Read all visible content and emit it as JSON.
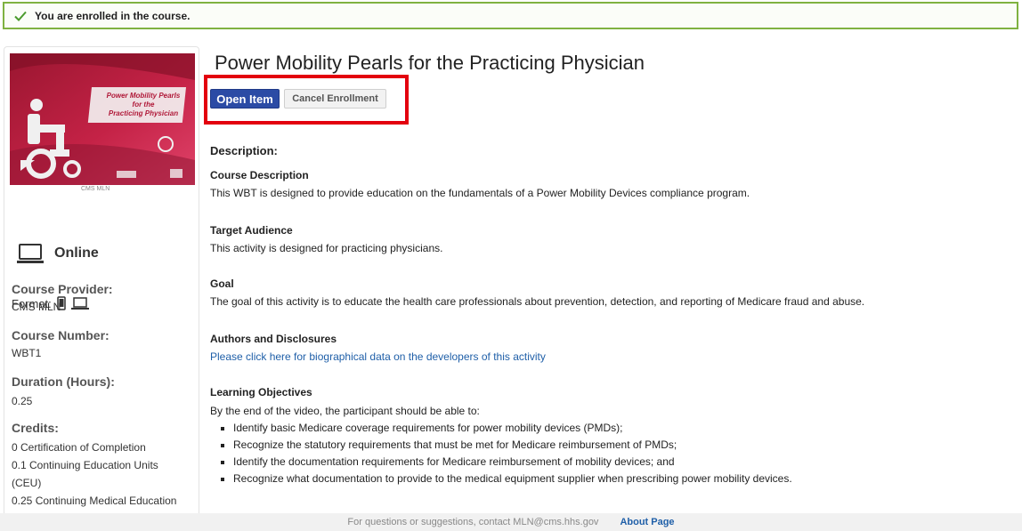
{
  "banner": {
    "message": "You are enrolled in the course.",
    "icon": "checkmark-icon",
    "color": "#7fb241"
  },
  "sidebar": {
    "thumbnail": {
      "title_lines": [
        "Power Mobility Pearls",
        "for the",
        "Practicing Physician"
      ],
      "caption": "CMS MLN"
    },
    "delivery": {
      "icon": "laptop-icon",
      "label": "Online"
    },
    "format": {
      "label": "Format:",
      "icons": [
        "mobile-icon",
        "laptop-icon"
      ]
    },
    "provider": {
      "label": "Course Provider:",
      "value": "CMS MLN"
    },
    "number": {
      "label": "Course Number:",
      "value": "WBT1"
    },
    "duration": {
      "label": "Duration (Hours):",
      "value": "0.25"
    },
    "credits": {
      "label": "Credits:",
      "values": [
        "0 Certification of Completion",
        "0.1 Continuing Education Units",
        "(CEU)",
        "0.25 Continuing Medical Education"
      ]
    }
  },
  "main": {
    "title": "Power Mobility Pearls for the Practicing Physician",
    "buttons": {
      "open": "Open Item",
      "cancel": "Cancel Enrollment"
    },
    "description_heading": "Description:",
    "sections": {
      "course_description": {
        "heading": "Course Description",
        "text": "This WBT is designed to provide education on the fundamentals of a Power Mobility Devices compliance program."
      },
      "target_audience": {
        "heading": "Target Audience",
        "text": "This activity is designed for practicing physicians."
      },
      "goal": {
        "heading": "Goal",
        "text": "The goal of this activity is to educate the health care professionals about prevention, detection, and reporting of Medicare fraud and abuse."
      },
      "authors": {
        "heading": "Authors and Disclosures",
        "link": "Please click here for biographical data on the developers of this activity"
      },
      "objectives": {
        "heading": "Learning Objectives",
        "intro": "By the end of the video, the participant should be able to:",
        "items": [
          "Identify basic Medicare coverage requirements for power mobility devices (PMDs);",
          "Recognize the statutory requirements that must be met for Medicare reimbursement of PMDs;",
          "Identify the documentation requirements for Medicare reimbursement of mobility devices; and",
          "Recognize what documentation to provide to the medical equipment supplier when prescribing power mobility devices."
        ]
      }
    }
  },
  "footer": {
    "text": "For questions or suggestions, contact MLN@cms.hhs.gov",
    "about": "About Page"
  },
  "colors": {
    "primary_button": "#2b4ba5",
    "highlight_box": "#e3000e",
    "link": "#1f5fa8"
  }
}
